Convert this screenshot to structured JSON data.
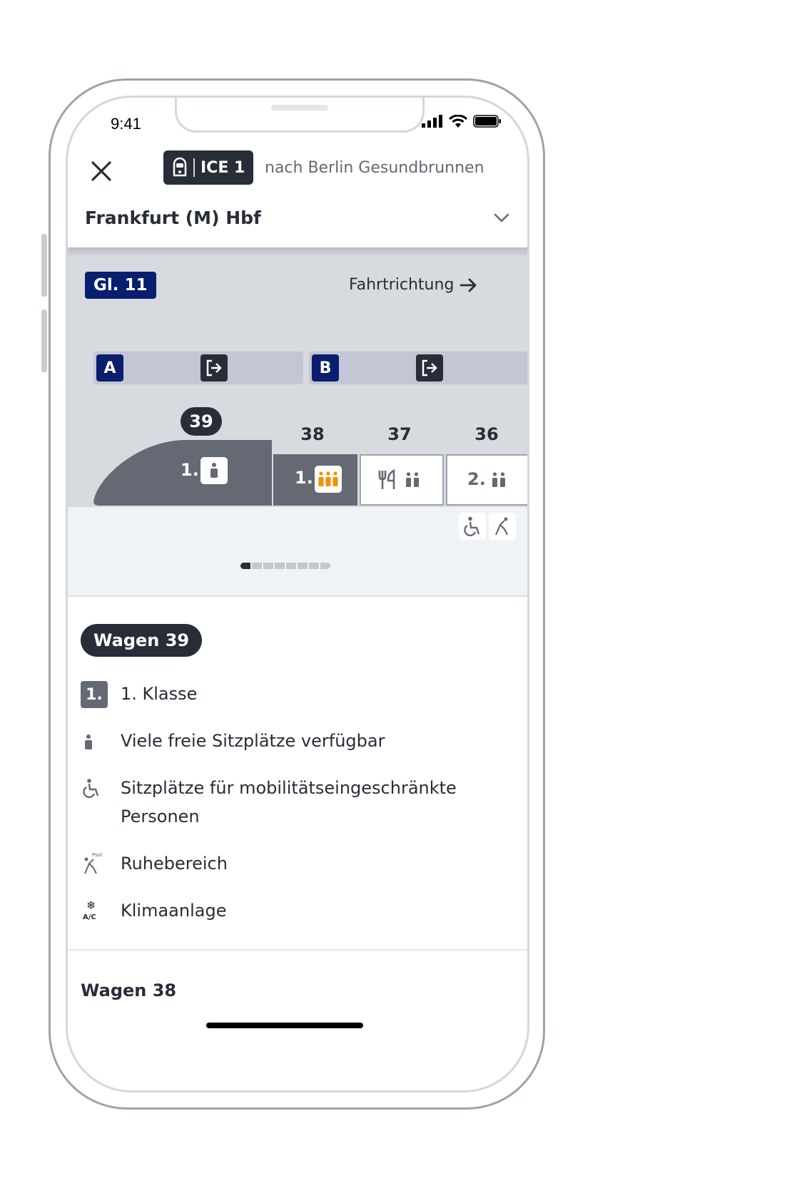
{
  "status": {
    "time": "9:41"
  },
  "header": {
    "train_type": "ICE 1",
    "destination": "nach Berlin Gesundbrunnen",
    "station": "Frankfurt (M) Hbf"
  },
  "platform": {
    "track": "Gl. 11",
    "direction_label": "Fahrtrichtung",
    "sectors": [
      "A",
      "B"
    ]
  },
  "train": {
    "wagons": [
      {
        "number": "39",
        "class": "1.",
        "occupancy": "low",
        "selected": true
      },
      {
        "number": "38",
        "class": "1.",
        "occupancy": "high"
      },
      {
        "number": "37",
        "class": "",
        "type": "restaurant",
        "occupancy": "medium"
      },
      {
        "number": "36",
        "class": "2.",
        "occupancy": "medium"
      }
    ],
    "occupancy_colors": {
      "high": "#f39200",
      "low": "#646973"
    },
    "scroll_position": 1,
    "scroll_total": 8
  },
  "detail": {
    "title": "Wagen 39",
    "features": [
      {
        "icon": "first-class-icon",
        "badge": "1.",
        "text": "1. Klasse"
      },
      {
        "icon": "occupancy-low-icon",
        "text": "Viele freie Sitzplätze verfügbar"
      },
      {
        "icon": "wheelchair-icon",
        "text": "Sitzplätze für mobilitätseingeschränkte Personen"
      },
      {
        "icon": "quiet-zone-icon",
        "text": "Ruhebereich",
        "icon_text": "Psst"
      },
      {
        "icon": "air-conditioning-icon",
        "text": "Klimaanlage",
        "icon_text": "A/C"
      }
    ],
    "next_title": "Wagen 38"
  },
  "colors": {
    "navy": "#0a1e6e",
    "dark": "#282d37",
    "platform_gray": "#d7dadf",
    "wagon_gray": "#646973"
  }
}
